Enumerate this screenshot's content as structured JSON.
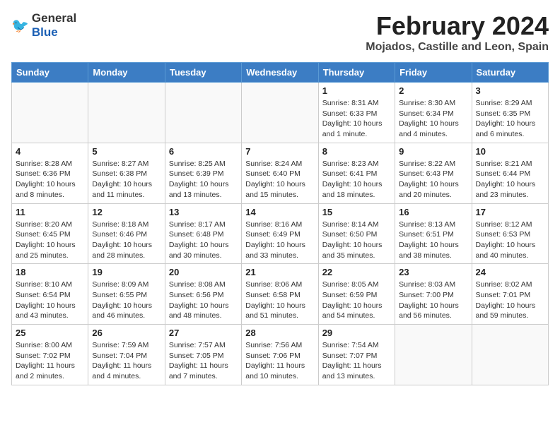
{
  "header": {
    "title": "February 2024",
    "location": "Mojados, Castille and Leon, Spain",
    "logo_general": "General",
    "logo_blue": "Blue"
  },
  "weekdays": [
    "Sunday",
    "Monday",
    "Tuesday",
    "Wednesday",
    "Thursday",
    "Friday",
    "Saturday"
  ],
  "weeks": [
    [
      {
        "day": "",
        "info": ""
      },
      {
        "day": "",
        "info": ""
      },
      {
        "day": "",
        "info": ""
      },
      {
        "day": "",
        "info": ""
      },
      {
        "day": "1",
        "info": "Sunrise: 8:31 AM\nSunset: 6:33 PM\nDaylight: 10 hours and 1 minute."
      },
      {
        "day": "2",
        "info": "Sunrise: 8:30 AM\nSunset: 6:34 PM\nDaylight: 10 hours and 4 minutes."
      },
      {
        "day": "3",
        "info": "Sunrise: 8:29 AM\nSunset: 6:35 PM\nDaylight: 10 hours and 6 minutes."
      }
    ],
    [
      {
        "day": "4",
        "info": "Sunrise: 8:28 AM\nSunset: 6:36 PM\nDaylight: 10 hours and 8 minutes."
      },
      {
        "day": "5",
        "info": "Sunrise: 8:27 AM\nSunset: 6:38 PM\nDaylight: 10 hours and 11 minutes."
      },
      {
        "day": "6",
        "info": "Sunrise: 8:25 AM\nSunset: 6:39 PM\nDaylight: 10 hours and 13 minutes."
      },
      {
        "day": "7",
        "info": "Sunrise: 8:24 AM\nSunset: 6:40 PM\nDaylight: 10 hours and 15 minutes."
      },
      {
        "day": "8",
        "info": "Sunrise: 8:23 AM\nSunset: 6:41 PM\nDaylight: 10 hours and 18 minutes."
      },
      {
        "day": "9",
        "info": "Sunrise: 8:22 AM\nSunset: 6:43 PM\nDaylight: 10 hours and 20 minutes."
      },
      {
        "day": "10",
        "info": "Sunrise: 8:21 AM\nSunset: 6:44 PM\nDaylight: 10 hours and 23 minutes."
      }
    ],
    [
      {
        "day": "11",
        "info": "Sunrise: 8:20 AM\nSunset: 6:45 PM\nDaylight: 10 hours and 25 minutes."
      },
      {
        "day": "12",
        "info": "Sunrise: 8:18 AM\nSunset: 6:46 PM\nDaylight: 10 hours and 28 minutes."
      },
      {
        "day": "13",
        "info": "Sunrise: 8:17 AM\nSunset: 6:48 PM\nDaylight: 10 hours and 30 minutes."
      },
      {
        "day": "14",
        "info": "Sunrise: 8:16 AM\nSunset: 6:49 PM\nDaylight: 10 hours and 33 minutes."
      },
      {
        "day": "15",
        "info": "Sunrise: 8:14 AM\nSunset: 6:50 PM\nDaylight: 10 hours and 35 minutes."
      },
      {
        "day": "16",
        "info": "Sunrise: 8:13 AM\nSunset: 6:51 PM\nDaylight: 10 hours and 38 minutes."
      },
      {
        "day": "17",
        "info": "Sunrise: 8:12 AM\nSunset: 6:53 PM\nDaylight: 10 hours and 40 minutes."
      }
    ],
    [
      {
        "day": "18",
        "info": "Sunrise: 8:10 AM\nSunset: 6:54 PM\nDaylight: 10 hours and 43 minutes."
      },
      {
        "day": "19",
        "info": "Sunrise: 8:09 AM\nSunset: 6:55 PM\nDaylight: 10 hours and 46 minutes."
      },
      {
        "day": "20",
        "info": "Sunrise: 8:08 AM\nSunset: 6:56 PM\nDaylight: 10 hours and 48 minutes."
      },
      {
        "day": "21",
        "info": "Sunrise: 8:06 AM\nSunset: 6:58 PM\nDaylight: 10 hours and 51 minutes."
      },
      {
        "day": "22",
        "info": "Sunrise: 8:05 AM\nSunset: 6:59 PM\nDaylight: 10 hours and 54 minutes."
      },
      {
        "day": "23",
        "info": "Sunrise: 8:03 AM\nSunset: 7:00 PM\nDaylight: 10 hours and 56 minutes."
      },
      {
        "day": "24",
        "info": "Sunrise: 8:02 AM\nSunset: 7:01 PM\nDaylight: 10 hours and 59 minutes."
      }
    ],
    [
      {
        "day": "25",
        "info": "Sunrise: 8:00 AM\nSunset: 7:02 PM\nDaylight: 11 hours and 2 minutes."
      },
      {
        "day": "26",
        "info": "Sunrise: 7:59 AM\nSunset: 7:04 PM\nDaylight: 11 hours and 4 minutes."
      },
      {
        "day": "27",
        "info": "Sunrise: 7:57 AM\nSunset: 7:05 PM\nDaylight: 11 hours and 7 minutes."
      },
      {
        "day": "28",
        "info": "Sunrise: 7:56 AM\nSunset: 7:06 PM\nDaylight: 11 hours and 10 minutes."
      },
      {
        "day": "29",
        "info": "Sunrise: 7:54 AM\nSunset: 7:07 PM\nDaylight: 11 hours and 13 minutes."
      },
      {
        "day": "",
        "info": ""
      },
      {
        "day": "",
        "info": ""
      }
    ]
  ]
}
